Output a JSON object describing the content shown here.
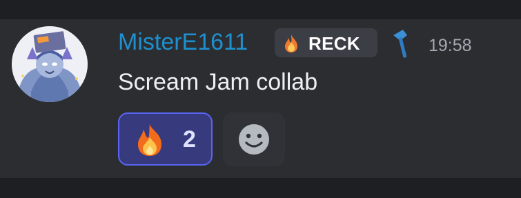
{
  "message": {
    "username": "MisterE1611",
    "tag": "RECK",
    "timestamp": "19:58",
    "content": "Scream Jam collab",
    "reaction": {
      "emoji": "fire",
      "count": "2"
    }
  },
  "icons": {
    "tag_badge": "fire-icon",
    "role": "pickaxe-icon",
    "reaction": "fire-emoji",
    "add_reaction": "smiley-icon"
  },
  "colors": {
    "username": "#1e90cf",
    "reaction_border": "#5865f2",
    "reaction_bg": "#373a7c",
    "message_bg": "#2b2d31"
  }
}
